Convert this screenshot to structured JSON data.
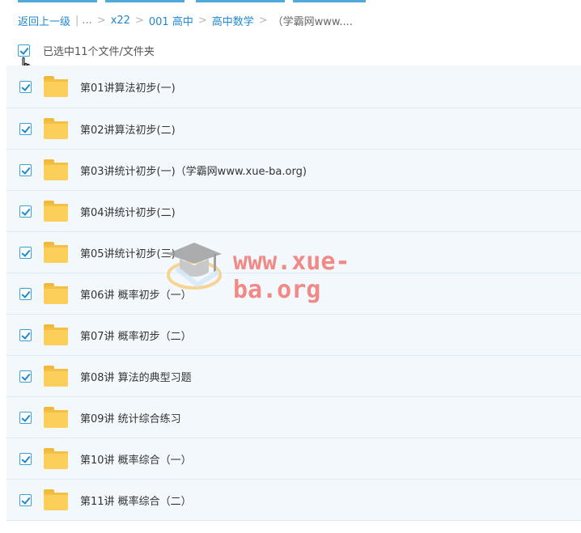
{
  "breadcrumb": {
    "back": "返回上一级",
    "ellipsis": "...",
    "items": [
      "x22",
      "001 高中",
      "高中数学"
    ],
    "current": "（学霸网www...."
  },
  "selection": {
    "label": "已选中11个文件/文件夹"
  },
  "files": [
    {
      "name": "第01讲算法初步(一)"
    },
    {
      "name": "第02讲算法初步(二)"
    },
    {
      "name": "第03讲统计初步(一)（学霸网www.xue-ba.org)"
    },
    {
      "name": "第04讲统计初步(二)"
    },
    {
      "name": "第05讲统计初步(三)"
    },
    {
      "name": "第06讲 概率初步（一）"
    },
    {
      "name": "第07讲 概率初步（二）"
    },
    {
      "name": "第08讲 算法的典型习题"
    },
    {
      "name": "第09讲 统计综合练习"
    },
    {
      "name": "第10讲 概率综合（一）"
    },
    {
      "name": "第11讲 概率综合（二）"
    }
  ],
  "watermark": {
    "text": "www.xue-ba.org"
  },
  "colors": {
    "link": "#1e88d0",
    "row_bg": "#f3f8fc",
    "folder": "#fccf5a",
    "checkbox": "#3aa0e0"
  },
  "icons": {
    "folder": "folder-icon",
    "checkbox": "checkbox-checked-icon",
    "cursor": "hand-cursor-icon",
    "watermark_logo": "graduation-cap-icon"
  }
}
